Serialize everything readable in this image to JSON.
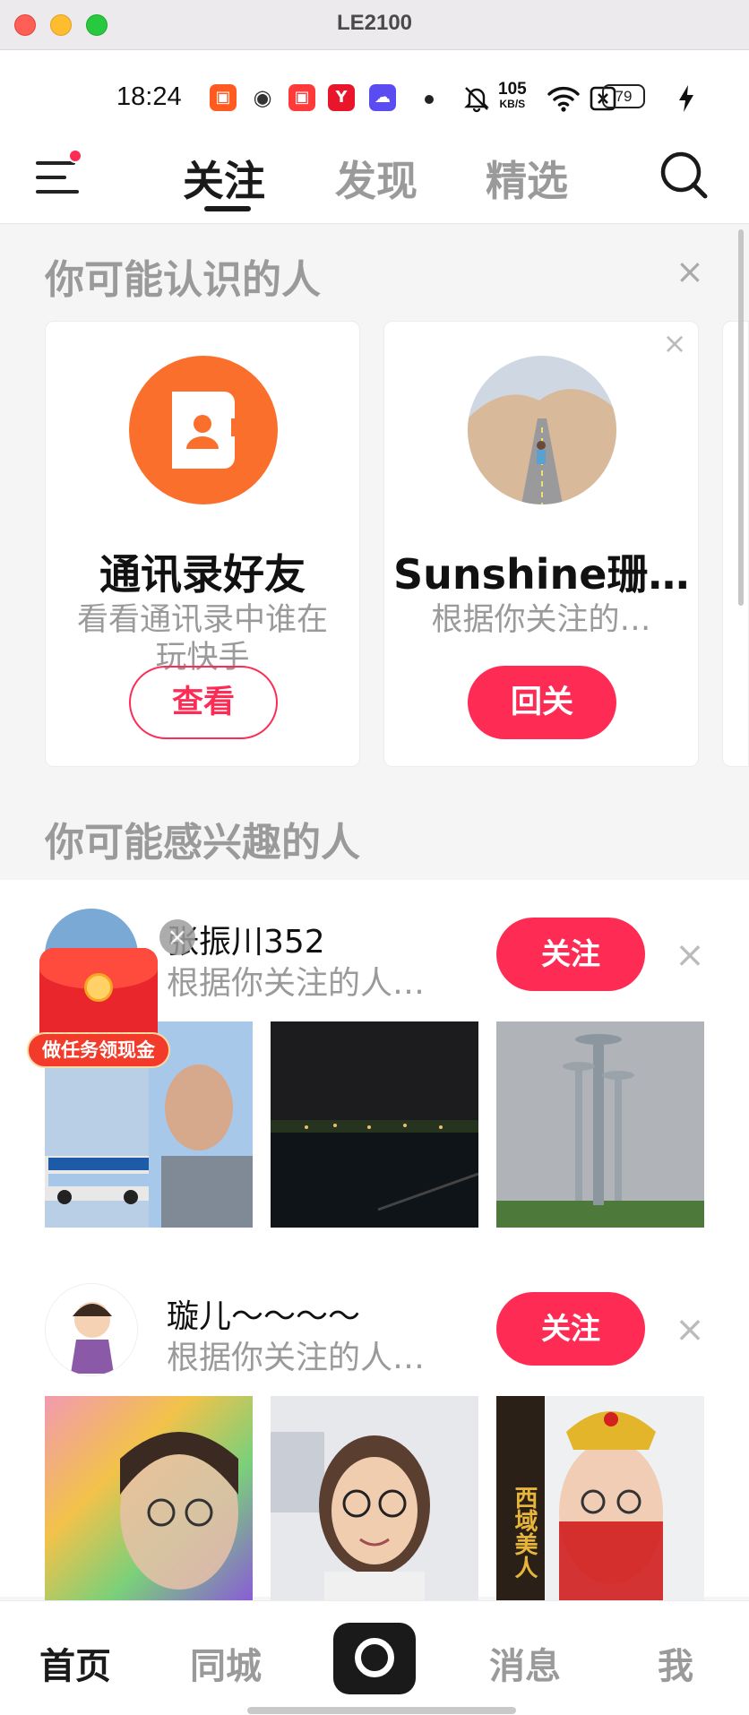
{
  "window": {
    "title": "LE2100"
  },
  "status_bar": {
    "time": "18:24",
    "net_speed_value": "105",
    "net_speed_unit": "KB/S",
    "battery": "79",
    "app_icons": [
      {
        "name": "kuaishou-app-icon",
        "color": "#ff5a1f"
      },
      {
        "name": "globe-app-icon",
        "color": "#333333"
      },
      {
        "name": "kuaishou-lite-app-icon",
        "color": "#ff3a3a"
      },
      {
        "name": "red-app-icon",
        "color": "#e8152b"
      },
      {
        "name": "weather-app-icon",
        "color": "#5b4cf2"
      }
    ]
  },
  "top_nav": {
    "tabs": [
      {
        "label": "关注",
        "active": true
      },
      {
        "label": "发现",
        "active": false
      },
      {
        "label": "精选",
        "active": false
      }
    ]
  },
  "people_you_may_know": {
    "title": "你可能认识的人",
    "cards": [
      {
        "name": "通讯录好友",
        "desc": "看看通讯录中谁在玩快手",
        "button": "查看"
      },
      {
        "name": "Sunshine珊…",
        "desc": "根据你关注的…",
        "button": "回关"
      }
    ]
  },
  "people_you_may_like": {
    "title": "你可能感兴趣的人",
    "users": [
      {
        "name": "张振川352",
        "reason": "根据你关注的人…",
        "follow": "关注"
      },
      {
        "name": "璇儿～～～～",
        "reason": "根据你关注的人…",
        "follow": "关注"
      }
    ]
  },
  "red_packet": {
    "label": "做任务领现金"
  },
  "thumb_overlay_text": "西域美人",
  "bottom_nav": {
    "items": [
      {
        "label": "首页",
        "active": true
      },
      {
        "label": "同城",
        "active": false
      },
      {
        "label": "消息",
        "active": false
      },
      {
        "label": "我",
        "active": false
      }
    ]
  },
  "colors": {
    "accent": "#fe2c55",
    "muted_text": "#9a9a9a"
  }
}
